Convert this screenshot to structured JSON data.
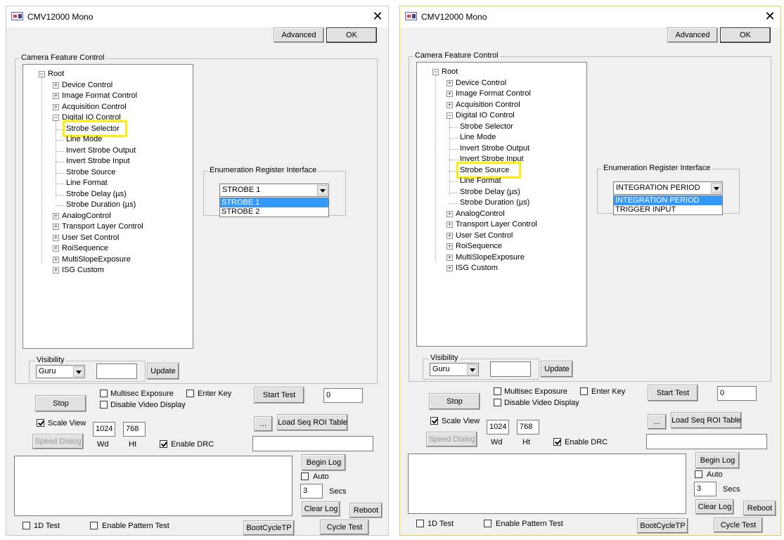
{
  "windows": [
    {
      "title": "CMV12000 Mono",
      "close_glyph": "✕",
      "advanced_label": "Advanced",
      "ok_label": "OK",
      "feature_group_title": "Camera Feature Control",
      "tree": {
        "root": "Root",
        "items": [
          {
            "label": "Device Control",
            "expander": "+"
          },
          {
            "label": "Image Format Control",
            "expander": "+"
          },
          {
            "label": "Acquisition Control",
            "expander": "+"
          },
          {
            "label": "Digital IO Control",
            "expander": "−"
          },
          {
            "label": "Strobe Selector",
            "child": true
          },
          {
            "label": "Line Mode",
            "child": true
          },
          {
            "label": "Invert Strobe Output",
            "child": true
          },
          {
            "label": "Invert Strobe Input",
            "child": true
          },
          {
            "label": "Strobe Source",
            "child": true
          },
          {
            "label": "Line Format",
            "child": true
          },
          {
            "label": "Strobe Delay (µs)",
            "child": true
          },
          {
            "label": "Strobe Duration (µs)",
            "child": true
          },
          {
            "label": "AnalogControl",
            "expander": "+"
          },
          {
            "label": "Transport Layer Control",
            "expander": "+"
          },
          {
            "label": "User Set Control",
            "expander": "+"
          },
          {
            "label": "RoiSequence",
            "expander": "+"
          },
          {
            "label": "MultiSlopeExposure",
            "expander": "+"
          },
          {
            "label": "ISG Custom",
            "expander": "+"
          }
        ],
        "highlighted_item": "Strobe Selector"
      },
      "enum_group_title": "Enumeration Register Interface",
      "enum_combo_value": "STROBE 1",
      "enum_options": [
        {
          "label": "STROBE 1",
          "selected": true
        },
        {
          "label": "STROBE 2",
          "selected": false
        }
      ],
      "visibility_title": "Visibility",
      "visibility_value": "Guru",
      "visibility_text": "",
      "update_label": "Update",
      "stop_label": "Stop",
      "multisec_label": "Multisec Exposure",
      "enter_key_label": "Enter Key",
      "disable_video_label": "Disable Video Display",
      "start_test_label": "Start Test",
      "test_count": "0",
      "scale_view_label": "Scale View",
      "scale_view_checked": true,
      "wd_value": "1024",
      "ht_value": "768",
      "wd_label": "Wd",
      "ht_label": "Ht",
      "speed_dialog_label": "Speed Dialog",
      "enable_drc_label": "Enable DRC",
      "enable_drc_checked": true,
      "ellipsis_label": "...",
      "load_seq_label": "Load Seq ROI Table",
      "seq_path": "",
      "begin_log_label": "Begin Log",
      "auto_label": "Auto",
      "secs_value": "3",
      "secs_label": "Secs",
      "clear_log_label": "Clear Log",
      "reboot_label": "Reboot",
      "test_1d_label": "1D Test",
      "pattern_test_label": "Enable Pattern Test",
      "bootcycle_label": "BootCycleTP",
      "cycle_test_label": "Cycle Test"
    },
    {
      "title": "CMV12000 Mono",
      "close_glyph": "✕",
      "advanced_label": "Advanced",
      "ok_label": "OK",
      "feature_group_title": "Camera Feature Control",
      "tree": {
        "root": "Root",
        "items": [
          {
            "label": "Device Control",
            "expander": "+"
          },
          {
            "label": "Image Format Control",
            "expander": "+"
          },
          {
            "label": "Acquisition Control",
            "expander": "+"
          },
          {
            "label": "Digital IO Control",
            "expander": "−"
          },
          {
            "label": "Strobe Selector",
            "child": true
          },
          {
            "label": "Line Mode",
            "child": true
          },
          {
            "label": "Invert Strobe Output",
            "child": true
          },
          {
            "label": "Invert Strobe Input",
            "child": true
          },
          {
            "label": "Strobe Source",
            "child": true
          },
          {
            "label": "Line Format",
            "child": true
          },
          {
            "label": "Strobe Delay (µs)",
            "child": true
          },
          {
            "label": "Strobe Duration (µs)",
            "child": true
          },
          {
            "label": "AnalogControl",
            "expander": "+"
          },
          {
            "label": "Transport Layer Control",
            "expander": "+"
          },
          {
            "label": "User Set Control",
            "expander": "+"
          },
          {
            "label": "RoiSequence",
            "expander": "+"
          },
          {
            "label": "MultiSlopeExposure",
            "expander": "+"
          },
          {
            "label": "ISG Custom",
            "expander": "+"
          }
        ],
        "highlighted_item": "Strobe Source"
      },
      "enum_group_title": "Enumeration Register Interface",
      "enum_combo_value": "INTEGRATION PERIOD",
      "enum_options": [
        {
          "label": "INTEGRATION PERIOD",
          "selected": true
        },
        {
          "label": "TRIGGER INPUT",
          "selected": false
        }
      ],
      "visibility_title": "Visibility",
      "visibility_value": "Guru",
      "visibility_text": "",
      "update_label": "Update",
      "stop_label": "Stop",
      "multisec_label": "Multisec Exposure",
      "enter_key_label": "Enter Key",
      "disable_video_label": "Disable Video Display",
      "start_test_label": "Start Test",
      "test_count": "0",
      "scale_view_label": "Scale View",
      "scale_view_checked": true,
      "wd_value": "1024",
      "ht_value": "768",
      "wd_label": "Wd",
      "ht_label": "Ht",
      "speed_dialog_label": "Speed Dialog",
      "enable_drc_label": "Enable DRC",
      "enable_drc_checked": true,
      "ellipsis_label": "...",
      "load_seq_label": "Load Seq ROI Table",
      "seq_path": "",
      "begin_log_label": "Begin Log",
      "auto_label": "Auto",
      "secs_value": "3",
      "secs_label": "Secs",
      "clear_log_label": "Clear Log",
      "reboot_label": "Reboot",
      "test_1d_label": "1D Test",
      "pattern_test_label": "Enable Pattern Test",
      "bootcycle_label": "BootCycleTP",
      "cycle_test_label": "Cycle Test"
    }
  ],
  "colors": {
    "highlight": "#ffef00",
    "selection": "#3399ff",
    "dialog_bg": "#f0f0f0"
  }
}
